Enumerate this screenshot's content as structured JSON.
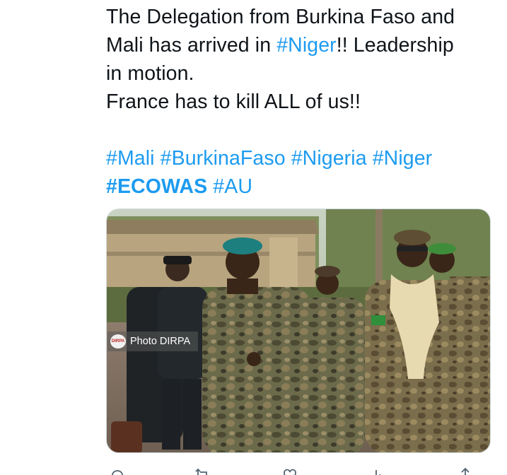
{
  "tweet": {
    "line1": "The Delegation from Burkina Faso and",
    "line2_prefix": "Mali has arrived in ",
    "line2_hashtag": "#Niger",
    "line2_suffix": "!! Leadership",
    "line3": "in motion.",
    "line4": "France has to kill ALL of us!!",
    "hashtags_line1": [
      "#Mali",
      "#BurkinaFaso",
      "#Nigeria",
      "#Niger"
    ],
    "hashtags_line2_bold": "#ECOWAS",
    "hashtags_line2_rest": "#AU"
  },
  "media": {
    "watermark_logo": "DIRPA",
    "watermark_text": "Photo DIRPA"
  },
  "actions": [
    "reply-icon",
    "retweet-icon",
    "like-icon",
    "views-icon",
    "share-icon"
  ],
  "colors": {
    "hashtag": "#1d9bf0",
    "text": "#0f1419"
  }
}
